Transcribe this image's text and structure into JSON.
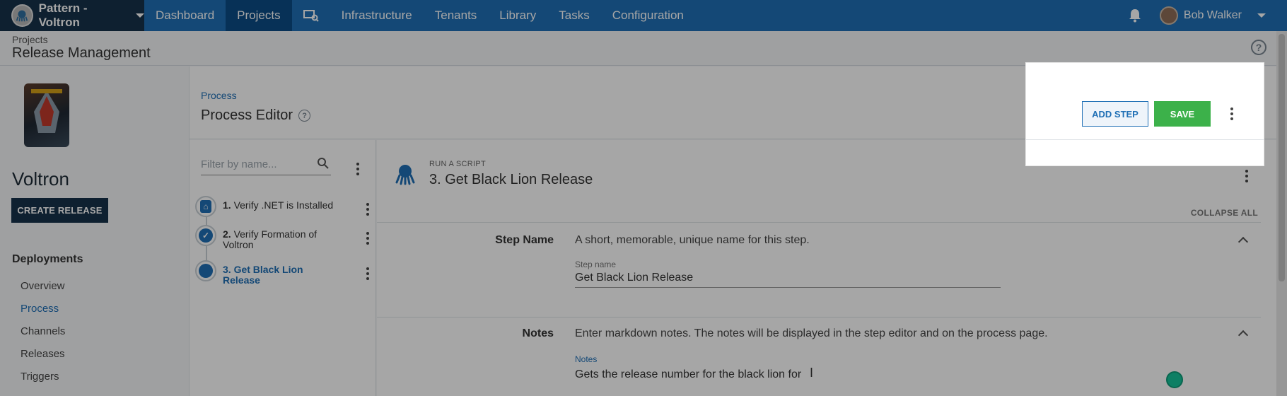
{
  "topnav": {
    "space_name": "Pattern - Voltron",
    "items": [
      "Dashboard",
      "Projects",
      "",
      "Infrastructure",
      "Tenants",
      "Library",
      "Tasks",
      "Configuration"
    ],
    "active": "Projects",
    "user_name": "Bob Walker",
    "color": "#1f6fb5"
  },
  "page": {
    "breadcrumb": "Projects",
    "title": "Release Management"
  },
  "sidebar": {
    "project_name": "Voltron",
    "create_release": "CREATE RELEASE",
    "deployments_heading": "Deployments",
    "links": [
      "Overview",
      "Process",
      "Channels",
      "Releases",
      "Triggers"
    ],
    "active_link": "Process"
  },
  "main": {
    "breadcrumb": "Process",
    "title": "Process Editor"
  },
  "steplist": {
    "filter_placeholder": "Filter by name...",
    "steps": [
      {
        "num": "1.",
        "name": "Verify .NET is Installed"
      },
      {
        "num": "2.",
        "name": "Verify Formation of Voltron"
      },
      {
        "num": "3.",
        "name": "Get Black Lion Release"
      }
    ]
  },
  "editor": {
    "step_type": "RUN A SCRIPT",
    "step_title": "3.  Get Black Lion Release",
    "collapse_all": "COLLAPSE ALL",
    "step_name_section": {
      "label": "Step Name",
      "description": "A short, memorable, unique name for this step.",
      "field_label": "Step name",
      "value": "Get Black Lion Release"
    },
    "notes_section": {
      "label": "Notes",
      "description": "Enter markdown notes. The notes will be displayed in the step editor and on the process page.",
      "field_label": "Notes",
      "value": "Gets the release number for the black lion for"
    }
  },
  "toolbar": {
    "add_step": "ADD STEP",
    "save": "SAVE",
    "save_color": "#3cb14a"
  }
}
